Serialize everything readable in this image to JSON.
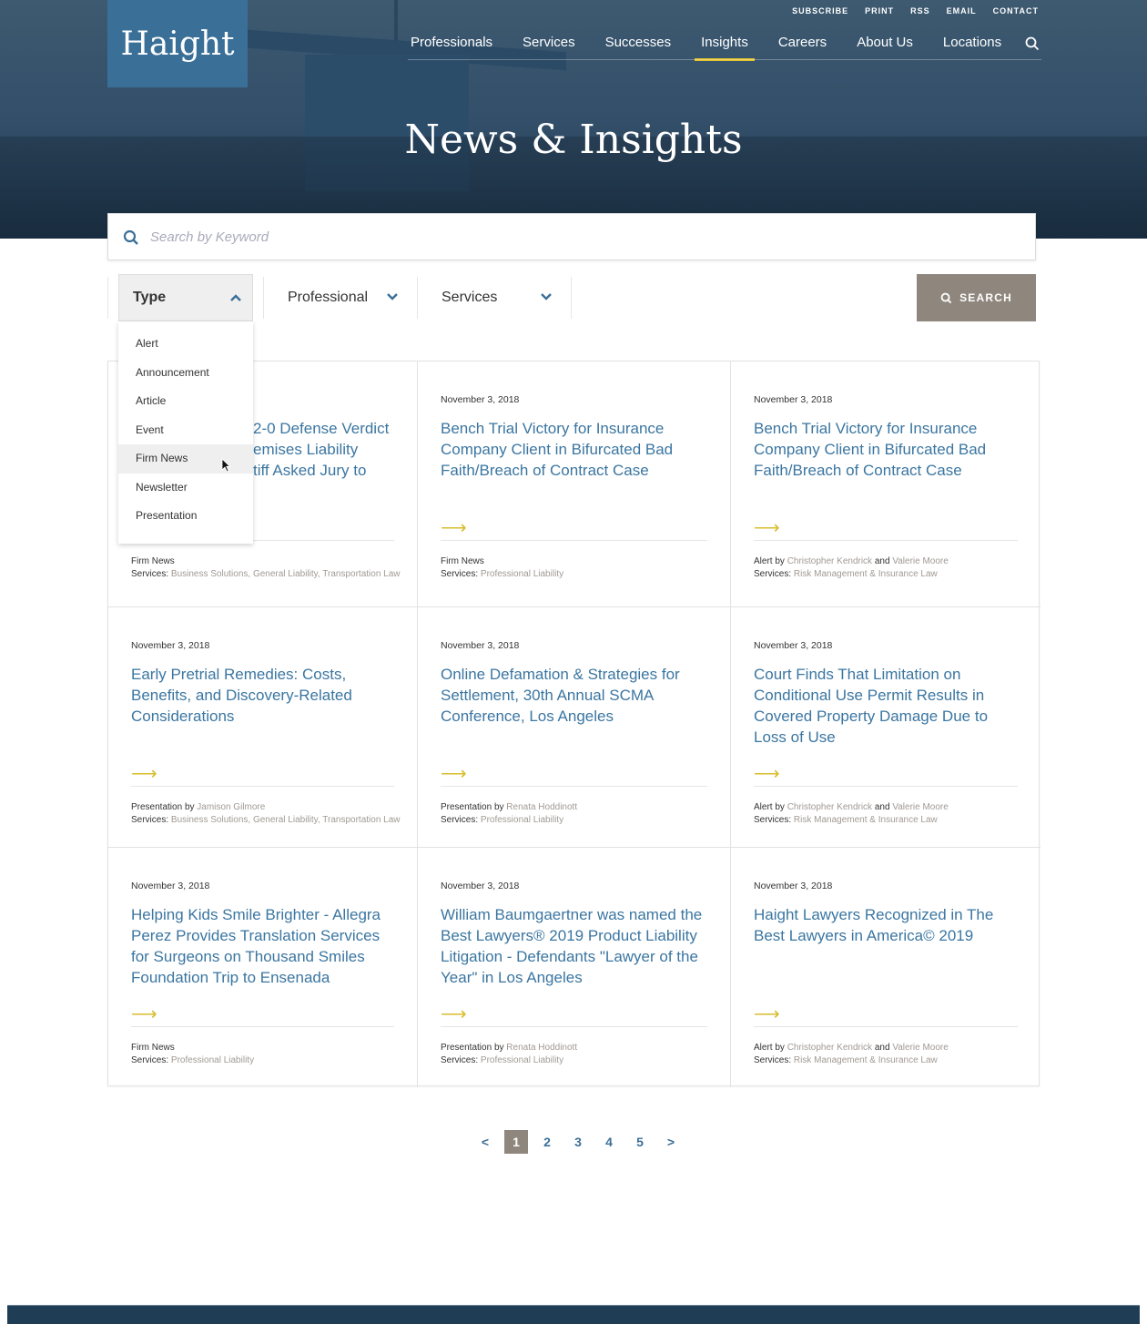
{
  "header": {
    "logo": "Haight",
    "utility_links": [
      "SUBSCRIBE",
      "PRINT",
      "RSS",
      "EMAIL",
      "CONTACT"
    ],
    "nav": [
      {
        "label": "Professionals"
      },
      {
        "label": "Services"
      },
      {
        "label": "Successes"
      },
      {
        "label": "Insights",
        "active": true
      },
      {
        "label": "Careers"
      },
      {
        "label": "About Us"
      },
      {
        "label": "Locations"
      }
    ],
    "accent": "#e2c22a"
  },
  "hero": {
    "title": "News & Insights"
  },
  "search": {
    "placeholder": "Search by Keyword",
    "button": "SEARCH"
  },
  "filters": {
    "type": "Type",
    "professional": "Professional",
    "services": "Services",
    "type_options": [
      "Alert",
      "Announcement",
      "Article",
      "Event",
      "Firm News",
      "Newsletter",
      "Presentation"
    ],
    "hovered_option": "Firm News"
  },
  "cards": [
    {
      "date": "",
      "title_lines": [
        "2-0 Defense Verdict",
        "emises Liability",
        "tiff Asked Jury to"
      ],
      "type": "Firm News",
      "by": "",
      "services": "Business Solutions, General Liability, Transportation Law"
    },
    {
      "date": "November 3, 2018",
      "title": "Bench Trial Victory for Insurance Company Client in Bifurcated Bad Faith/Breach of Contract Case",
      "type": "Firm News",
      "by": "",
      "services": "Professional Liability"
    },
    {
      "date": "November 3, 2018",
      "title": "Bench Trial Victory for Insurance Company Client in Bifurcated Bad Faith/Breach of Contract Case",
      "type": "Alert",
      "by": "Christopher Kendrick",
      "by2": "Valerie Moore",
      "services": "Risk Management & Insurance Law"
    },
    {
      "date": "November 3, 2018",
      "title": "Early Pretrial Remedies: Costs, Benefits, and Discovery-Related Considerations",
      "type": "Presentation",
      "by": "Jamison Gilmore",
      "services": "Business Solutions, General Liability, Transportation Law"
    },
    {
      "date": "November 3, 2018",
      "title": "Online Defamation & Strategies for Settlement, 30th Annual SCMA Conference, Los Angeles",
      "type": "Presentation",
      "by": "Renata Hoddinott",
      "services": "Professional Liability"
    },
    {
      "date": "November 3, 2018",
      "title": "Court Finds That Limitation on Conditional Use Permit Results in Covered Property Damage Due to Loss of Use",
      "type": "Alert",
      "by": "Christopher Kendrick",
      "by2": "Valerie Moore",
      "services": "Risk Management & Insurance Law"
    },
    {
      "date": "November 3, 2018",
      "title": "Helping Kids Smile Brighter - Allegra Perez Provides Translation Services for Surgeons on Thousand Smiles Foundation Trip to Ensenada",
      "type": "Firm News",
      "by": "",
      "services": "Professional Liability"
    },
    {
      "date": "November 3, 2018",
      "title": "William Baumgaertner was named the Best Lawyers® 2019 Product Liability Litigation - Defendants \"Lawyer of the Year\" in Los Angeles",
      "type": "Presentation",
      "by": "Renata Hoddinott",
      "services": "Professional Liability"
    },
    {
      "date": "November 3, 2018",
      "title": "Haight Lawyers Recognized in The Best Lawyers in America© 2019",
      "type": "Alert",
      "by": "Christopher Kendrick",
      "by2": "Valerie Moore",
      "services": "Risk Management & Insurance Law"
    }
  ],
  "labels": {
    "by": "by",
    "and": "and",
    "services": "Services:",
    "arrow": "⟶"
  },
  "pagination": {
    "prev": "<",
    "pages": [
      "1",
      "2",
      "3",
      "4",
      "5"
    ],
    "current": "1",
    "next": ">"
  }
}
